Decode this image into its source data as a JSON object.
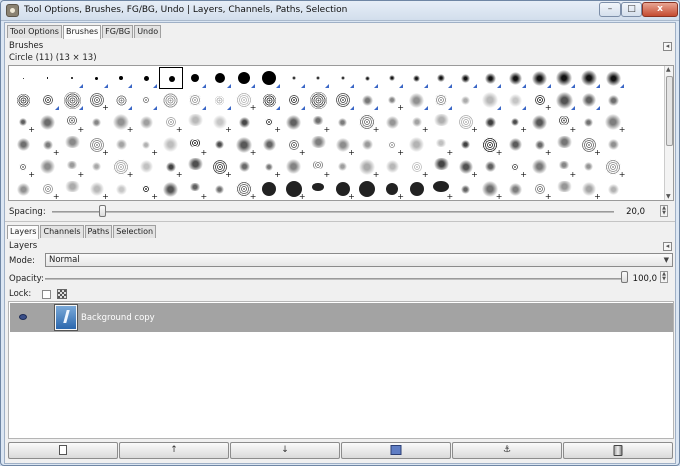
{
  "window": {
    "title": "Tool Options, Brushes, FG/BG, Undo | Layers, Channels, Paths, Selection",
    "controls": {
      "minimize": "–",
      "maximize": "□",
      "close": "x"
    }
  },
  "top_tabs": [
    "Tool Options",
    "Brushes",
    "FG/BG",
    "Undo"
  ],
  "brushes": {
    "panel_title": "Brushes",
    "selected_brush": "Circle (11) (13 × 13)",
    "spacing_label": "Spacing:",
    "spacing_value": "20,0",
    "spacing_fraction": 0.09
  },
  "bottom_tabs": [
    "Layers",
    "Channels",
    "Paths",
    "Selection"
  ],
  "layers": {
    "panel_title": "Layers",
    "mode_label": "Mode:",
    "mode_value": "Normal",
    "opacity_label": "Opacity:",
    "opacity_value": "100,0",
    "opacity_fraction": 1.0,
    "lock_label": "Lock:",
    "items": [
      {
        "name": "Background copy",
        "visible": true,
        "selected": true
      }
    ]
  },
  "bottom_buttons": [
    "new-layer",
    "raise-layer",
    "lower-layer",
    "duplicate-layer",
    "anchor-layer",
    "delete-layer"
  ],
  "colors": {
    "selection_row": "#a3a3a3",
    "close_button": "#c44b30",
    "preview_blue": "#3b67c6"
  }
}
